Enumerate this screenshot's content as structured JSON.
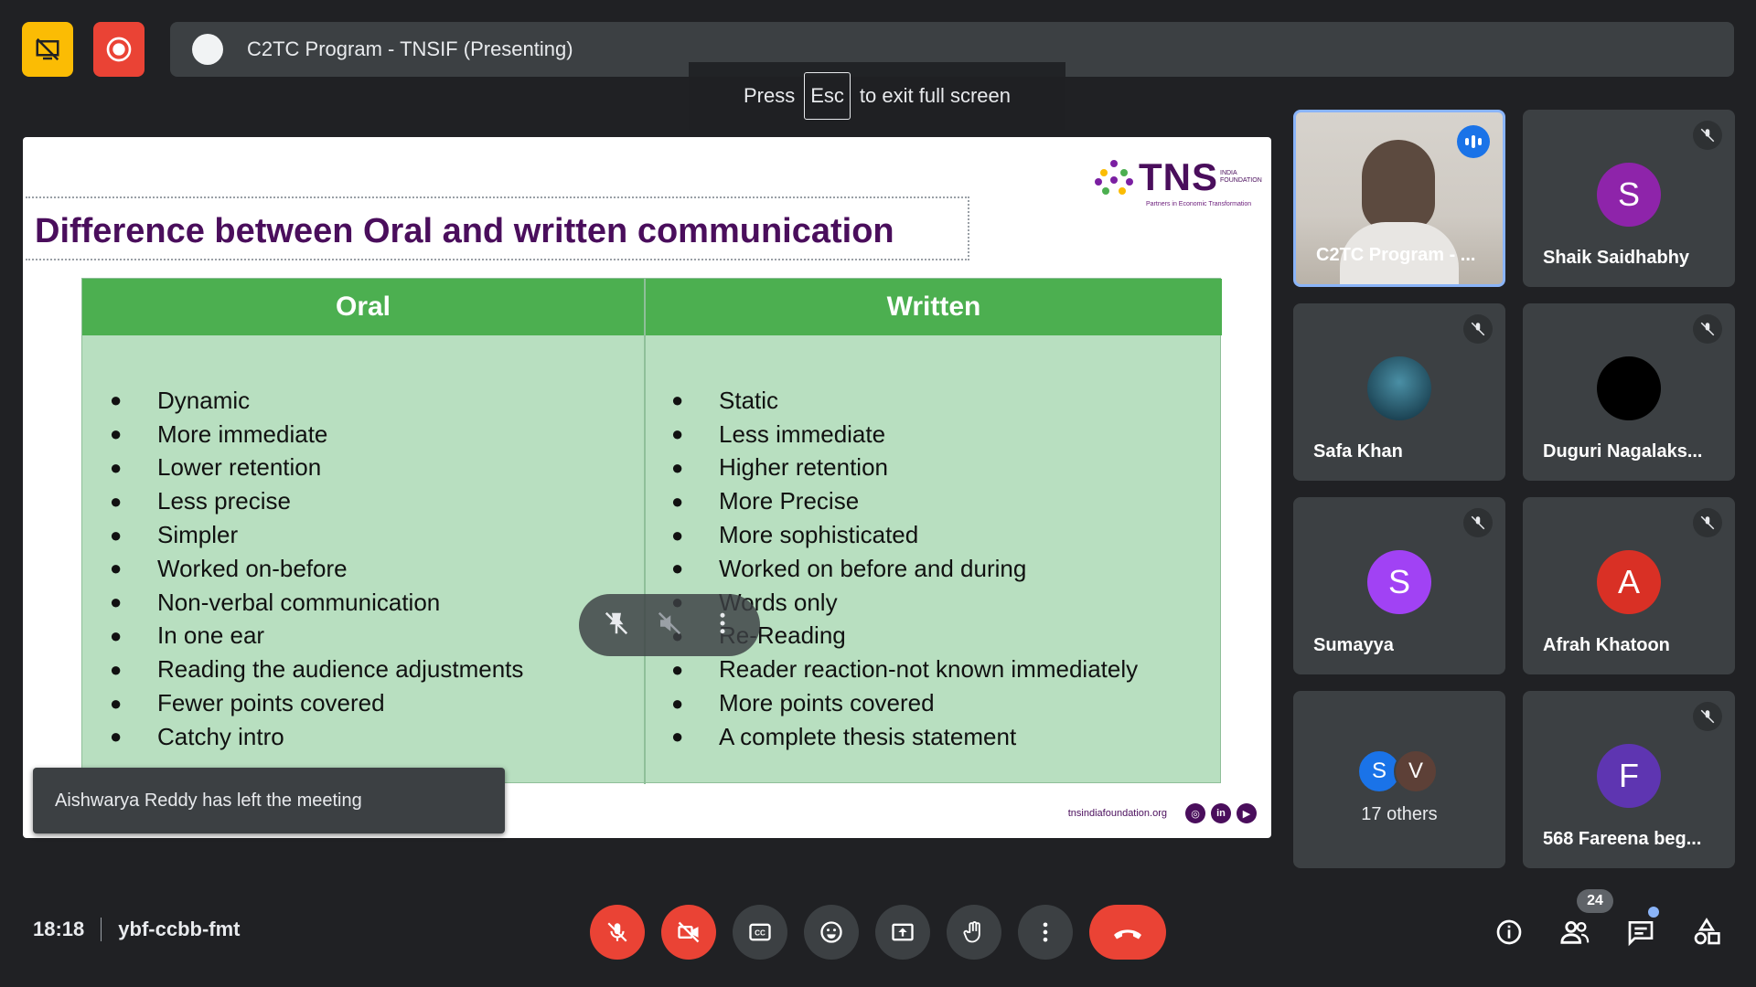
{
  "meeting": {
    "presentation_title": "C2TC Program - TNSIF (Presenting)",
    "time": "18:18",
    "code": "ybf-ccbb-fmt",
    "participant_count": "24"
  },
  "fullscreen_hint": {
    "press": "Press",
    "key": "Esc",
    "rest": "to exit full screen"
  },
  "slide": {
    "title": "Difference between Oral and written communication",
    "logo": {
      "brand": "TNS",
      "sub": "INDIA FOUNDATION",
      "tagline": "Partners in Economic Transformation"
    },
    "table": {
      "left_header": "Oral",
      "right_header": "Written",
      "left_items": [
        "Dynamic",
        "More immediate",
        "Lower retention",
        "Less precise",
        "Simpler",
        "Worked on-before",
        "Non-verbal communication",
        "In one ear",
        "Reading the audience adjustments",
        "Fewer points covered",
        "Catchy intro"
      ],
      "right_items": [
        "Static",
        "Less immediate",
        "Higher retention",
        "More Precise",
        "More sophisticated",
        "Worked on before and during",
        "Words only",
        "Re-Reading",
        "Reader reaction-not known immediately",
        "More points covered",
        "A complete thesis statement"
      ]
    },
    "footer_url": "tnsindiafoundation.org"
  },
  "toast": "Aishwarya Reddy has left the meeting",
  "participants": [
    {
      "name": "C2TC Program - ...",
      "type": "camera",
      "speaking": true
    },
    {
      "name": "Shaik Saidhabhy",
      "initial": "S",
      "color": "#8e24aa",
      "muted": true
    },
    {
      "name": "Safa Khan",
      "type": "photo",
      "muted": true
    },
    {
      "name": "Duguri Nagalaks...",
      "type": "black",
      "muted": true
    },
    {
      "name": "Sumayya",
      "initial": "S",
      "color": "#a142f4",
      "muted": true
    },
    {
      "name": "Afrah Khatoon",
      "initial": "A",
      "color": "#d93025",
      "muted": true
    },
    {
      "name": "17 others",
      "initials": [
        "S",
        "V"
      ],
      "colors": [
        "#1a73e8",
        "#5d4037"
      ]
    },
    {
      "name": "568 Fareena beg...",
      "initial": "F",
      "color": "#5e35b1",
      "muted": true
    }
  ],
  "icons": {
    "present": "presentation-off-icon",
    "record": "record-icon",
    "mic": "mic-off-icon",
    "cam": "camera-off-icon",
    "captions": "captions-icon",
    "emoji": "emoji-icon",
    "share": "present-screen-icon",
    "hand": "raise-hand-icon",
    "more": "more-vert-icon",
    "end": "end-call-icon",
    "info": "info-icon",
    "people": "people-icon",
    "chat": "chat-icon",
    "activities": "activities-icon"
  },
  "colors": {
    "accent_red": "#ea4335",
    "present_yellow": "#fbbc04",
    "slide_green": "#4caf50",
    "slide_title": "#4a0e5c"
  }
}
